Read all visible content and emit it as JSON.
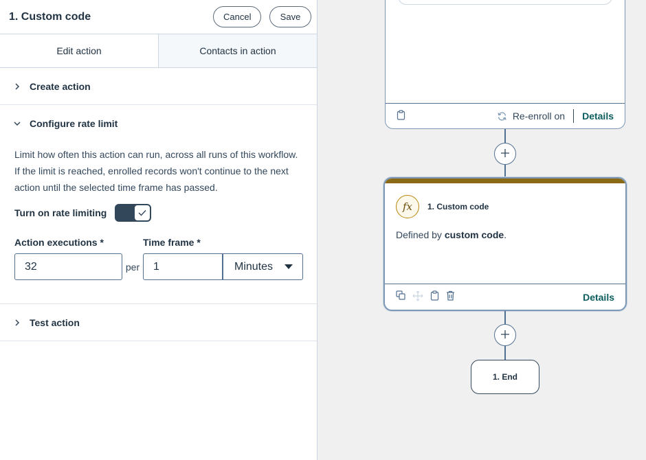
{
  "panel": {
    "title": "1. Custom code",
    "cancel_label": "Cancel",
    "save_label": "Save",
    "tabs": [
      {
        "label": "Edit action"
      },
      {
        "label": "Contacts in action"
      }
    ],
    "sections": {
      "create": "Create action",
      "rate": "Configure rate limit",
      "test": "Test action"
    },
    "rate": {
      "description": "Limit how often this action can run, across all runs of this workflow. If the limit is reached, enrolled records won't continue to the next action until the selected time frame has passed.",
      "toggle_label": "Turn on rate limiting",
      "toggle_on": true,
      "executions_label": "Action executions *",
      "executions_value": "32",
      "per_label": "per",
      "timeframe_label": "Time frame *",
      "timeframe_value": "1",
      "unit_value": "Minutes"
    }
  },
  "canvas": {
    "top_card": {
      "reenroll_label": "Re-enroll on",
      "details_label": "Details"
    },
    "code_card": {
      "title": "1. Custom code",
      "desc_prefix": "Defined by ",
      "desc_bold": "custom code",
      "desc_suffix": ".",
      "details_label": "Details",
      "accent_color": "#8a6a16"
    },
    "end_node": {
      "label": "1. End"
    }
  }
}
